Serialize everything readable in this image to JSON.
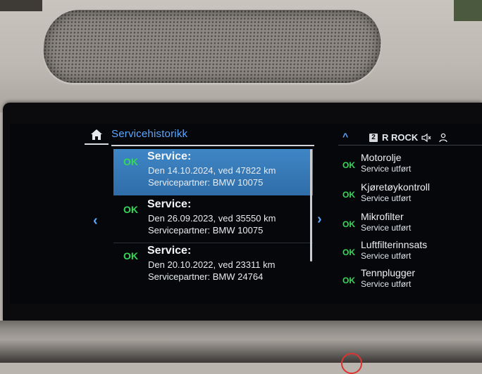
{
  "title": "Servicehistorikk",
  "nav": {
    "prev": "‹",
    "next": "›"
  },
  "entries": [
    {
      "status": "OK",
      "heading": "Service:",
      "date_line": "Den 14.10.2024, ved 47822 km",
      "partner_line": "Servicepartner: BMW 10075",
      "selected": true
    },
    {
      "status": "OK",
      "heading": "Service:",
      "date_line": "Den 26.09.2023, ved 35550 km",
      "partner_line": "Servicepartner: BMW 10075",
      "selected": false
    },
    {
      "status": "OK",
      "heading": "Service:",
      "date_line": "Den 20.10.2022, ved 23311 km",
      "partner_line": "Servicepartner: BMW 24764",
      "selected": false
    }
  ],
  "status_bar": {
    "expand_icon": "chevron-up-icon",
    "preset_number": "2",
    "station": "R ROCK",
    "mute_icon": "speaker-mute-icon",
    "profile_icon": "person-icon"
  },
  "checks": [
    {
      "status": "OK",
      "name": "Motorolje",
      "state": "Service utført"
    },
    {
      "status": "OK",
      "name": "Kjøretøykontroll",
      "state": "Service utført"
    },
    {
      "status": "OK",
      "name": "Mikrofilter",
      "state": "Service utført"
    },
    {
      "status": "OK",
      "name": "Luftfilterinnsats",
      "state": "Service utført"
    },
    {
      "status": "OK",
      "name": "Tennplugger",
      "state": "Service utført"
    }
  ],
  "colors": {
    "accent": "#5ea7ff",
    "ok": "#36d957",
    "selection": "#3a7dbd",
    "screen_bg": "#05070a"
  }
}
